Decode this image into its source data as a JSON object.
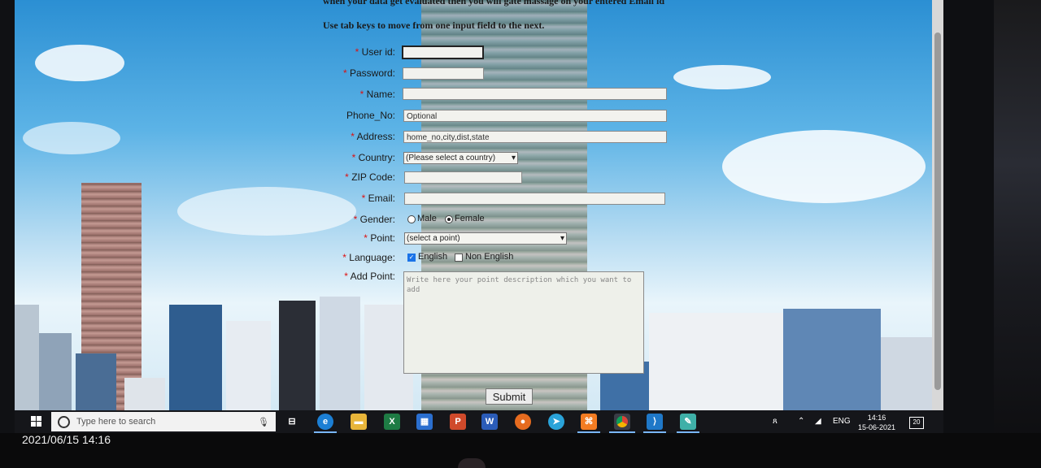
{
  "form": {
    "header_line1": "when your data get evaluated then you will gate massage on your entered Email id",
    "header_line2": "Use tab keys to move from one input field to the next.",
    "required_mark": "*",
    "fields": {
      "user_id": {
        "label": "User id:",
        "value": ""
      },
      "password": {
        "label": "Password:",
        "value": ""
      },
      "name": {
        "label": "Name:",
        "value": ""
      },
      "phone": {
        "label": "Phone_No:",
        "placeholder": "Optional"
      },
      "address": {
        "label": "Address:",
        "placeholder": "home_no,city,dist,state"
      },
      "country": {
        "label": "Country:",
        "selected": "(Please select a country)"
      },
      "zip": {
        "label": "ZIP Code:",
        "value": ""
      },
      "email": {
        "label": "Email:",
        "value": ""
      },
      "gender": {
        "label": "Gender:",
        "options": [
          "Male",
          "Female"
        ],
        "selected": "Female"
      },
      "point": {
        "label": "Point:",
        "selected": "(select a point)"
      },
      "language": {
        "label": "Language:",
        "options": [
          "English",
          "Non English"
        ],
        "checked": [
          "English"
        ]
      },
      "add_point": {
        "label": "Add Point:",
        "placeholder": "Write here your point description which you want to add"
      }
    },
    "submit_label": "Submit"
  },
  "taskbar": {
    "search_placeholder": "Type here to search",
    "apps": [
      "task-view",
      "edge",
      "file-explorer",
      "excel",
      "store",
      "powerpoint",
      "word",
      "firefox",
      "telegram",
      "xampp",
      "chrome",
      "vscode",
      "notepad"
    ],
    "tray": {
      "language": "ENG",
      "time": "14:16",
      "date": "15-06-2021",
      "notifications": "20"
    }
  },
  "photo_timestamp": "2021/06/15 14:16",
  "colors": {
    "required": "#dd1111",
    "taskbar": "#15161a",
    "accent": "#1a73e8"
  }
}
